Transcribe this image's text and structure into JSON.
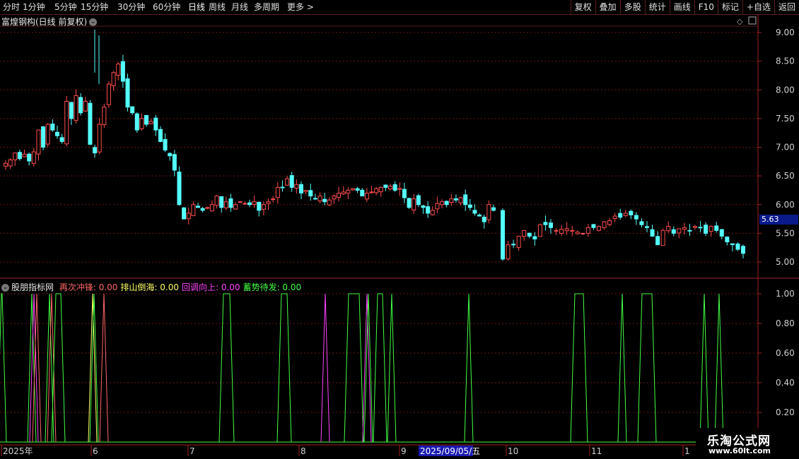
{
  "toolbar": {
    "periods": [
      "分时",
      "1分钟",
      "5分钟",
      "15分钟",
      "30分钟",
      "60分钟",
      "日线",
      "周线",
      "月线",
      "多周期",
      "更多 >"
    ],
    "active_period": "日线",
    "right_buttons": [
      "复权",
      "叠加",
      "多股",
      "统计",
      "画线",
      "F10",
      "标记",
      "+自选",
      "返回"
    ]
  },
  "main_chart": {
    "title": "富煌钢构(日线 前复权)",
    "y_ticks": [
      "9.00",
      "8.50",
      "8.00",
      "7.50",
      "7.00",
      "6.50",
      "6.00",
      "5.50",
      "5.00"
    ],
    "current_price": "5.63",
    "up_color": "#ff4d4d",
    "down_color": "#54ffff"
  },
  "indicator": {
    "name": "股朋指标网",
    "lines": [
      {
        "label": "再次冲锋:",
        "value": "0.00",
        "color": "#ff6666"
      },
      {
        "label": "排山倒海:",
        "value": "0.00",
        "color": "#ffff66"
      },
      {
        "label": "回调向上:",
        "value": "0.00",
        "color": "#ff44ff"
      },
      {
        "label": "蓄势待发:",
        "value": "0.00",
        "color": "#44ff44"
      }
    ],
    "y_ticks": [
      "1.00",
      "0.80",
      "0.60",
      "0.40",
      "0.20"
    ]
  },
  "x_axis": {
    "labels": [
      "2025年",
      "6",
      "7",
      "8",
      "9",
      "10",
      "11",
      "1"
    ],
    "highlight": "2025/09/05/五"
  },
  "watermark": {
    "line1": "乐淘公式网",
    "line2": "www.60lt.com"
  },
  "chart_data": {
    "type": "candlestick",
    "ylim": [
      4.9,
      9.1
    ],
    "candles_close": [
      6.72,
      6.78,
      6.9,
      6.8,
      6.88,
      6.76,
      6.92,
      7.3,
      7.0,
      7.4,
      7.3,
      7.2,
      7.1,
      7.8,
      7.5,
      7.9,
      7.6,
      7.8,
      7.05,
      6.9,
      7.4,
      7.7,
      8.1,
      8.3,
      8.45,
      8.15,
      7.7,
      7.6,
      7.3,
      7.5,
      7.4,
      7.45,
      7.3,
      7.1,
      6.95,
      6.85,
      6.6,
      6.0,
      5.75,
      5.85,
      6.0,
      5.95,
      5.9,
      5.95,
      6.0,
      6.15,
      5.95,
      6.05,
      5.95,
      6.0,
      6.05,
      6.02,
      6.0,
      6.05,
      5.9,
      6.0,
      6.05,
      6.1,
      6.3,
      6.3,
      6.45,
      6.3,
      6.35,
      6.2,
      6.25,
      6.15,
      6.1,
      6.15,
      6.05,
      6.08,
      6.15,
      6.2,
      6.22,
      6.25,
      6.28,
      6.25,
      6.15,
      6.2,
      6.22,
      6.28,
      6.3,
      6.3,
      6.32,
      6.25,
      6.28,
      6.12,
      5.95,
      6.1,
      6.0,
      5.95,
      5.85,
      5.9,
      6.02,
      6.05,
      6.0,
      6.1,
      6.08,
      6.12,
      6.0,
      5.95,
      5.85,
      5.8,
      5.7,
      6.0,
      5.9,
      5.05,
      5.3,
      5.3,
      5.45,
      5.55,
      5.45,
      5.4,
      5.65,
      5.65,
      5.6,
      5.55,
      5.57,
      5.58,
      5.55,
      5.52,
      5.5,
      5.6,
      5.6,
      5.62,
      5.7,
      5.72,
      5.8,
      5.78,
      5.85,
      5.82,
      5.75,
      5.65,
      5.6,
      5.45,
      5.3,
      5.55,
      5.62,
      5.5,
      5.58,
      5.6,
      5.55,
      5.62,
      5.6,
      5.5,
      5.62,
      5.55,
      5.45,
      5.35,
      5.3,
      5.22,
      5.15
    ]
  }
}
